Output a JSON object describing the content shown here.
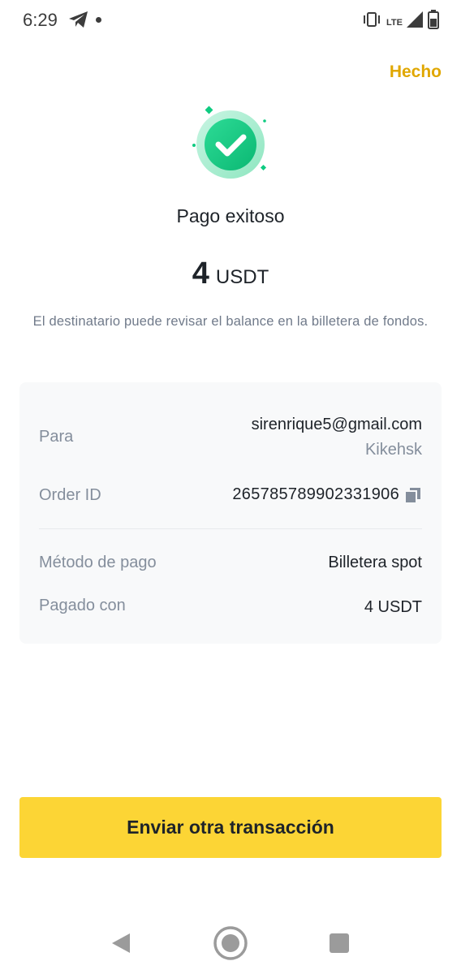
{
  "status_bar": {
    "time": "6:29",
    "network": "LTE",
    "icons": [
      "telegram-icon",
      "notification-dot",
      "vibrate-icon",
      "signal-icon",
      "battery-icon"
    ]
  },
  "header": {
    "done_label": "Hecho"
  },
  "result": {
    "icon": "check-circle-icon",
    "title": "Pago exitoso",
    "amount": "4",
    "unit": "USDT",
    "info": "El destinatario puede revisar el balance en la billetera de fondos."
  },
  "details": {
    "recipient_label": "Para",
    "recipient_email": "sirenrique5@gmail.com",
    "recipient_name": "Kikehsk",
    "order_label": "Order ID",
    "order_id": "265785789902331906",
    "method_label": "Método de pago",
    "method_value": "Billetera spot",
    "paid_label": "Pagado con",
    "paid_value": "4 USDT"
  },
  "actions": {
    "primary_label": "Enviar otra transacción"
  },
  "nav_bar": {
    "icons": [
      "back-icon",
      "home-icon",
      "recents-icon"
    ]
  },
  "colors": {
    "accent": "#fcd535",
    "link": "#e0a700",
    "success": "#0ecb81",
    "text_primary": "#1e2329",
    "text_secondary": "#848e9c",
    "card_bg": "#f8f9fa"
  }
}
